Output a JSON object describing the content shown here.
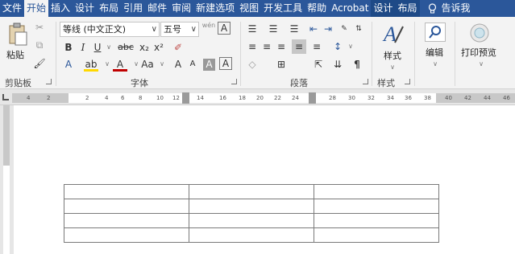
{
  "tabs": [
    {
      "label": "文件",
      "state": "normal"
    },
    {
      "label": "开始",
      "state": "active"
    },
    {
      "label": "插入",
      "state": "normal"
    },
    {
      "label": "设计",
      "state": "normal"
    },
    {
      "label": "布局",
      "state": "normal"
    },
    {
      "label": "引用",
      "state": "normal"
    },
    {
      "label": "邮件",
      "state": "normal"
    },
    {
      "label": "审阅",
      "state": "normal"
    },
    {
      "label": "新建选项",
      "state": "normal"
    },
    {
      "label": "视图",
      "state": "normal"
    },
    {
      "label": "开发工具",
      "state": "normal"
    },
    {
      "label": "帮助",
      "state": "normal"
    },
    {
      "label": "Acrobat",
      "state": "normal"
    },
    {
      "label": "设计",
      "state": "contextual"
    },
    {
      "label": "布局",
      "state": "contextual"
    }
  ],
  "tell_me": "告诉我",
  "clipboard": {
    "paste_label": "粘贴",
    "group_label": "剪贴板"
  },
  "font": {
    "name": "等线 (中文正文)",
    "size": "五号",
    "group_label": "字体",
    "buttons": {
      "bold": "B",
      "italic": "I",
      "underline": "U",
      "strike": "abc",
      "subscript": "x₂",
      "superscript": "x²",
      "change_case": "Aa",
      "grow": "A",
      "shrink": "A",
      "char_border": "A",
      "font_color": "A",
      "phonetic": "wén"
    }
  },
  "paragraph": {
    "group_label": "段落"
  },
  "styles": {
    "styles_label": "样式",
    "group_label": "样式"
  },
  "editing": {
    "label": "编辑"
  },
  "print_preview": {
    "label": "打印预览"
  },
  "ruler": {
    "numbers": [
      "4",
      "2",
      "2",
      "4",
      "6",
      "8",
      "10",
      "12",
      "14",
      "16",
      "18",
      "20",
      "22",
      "24",
      "28",
      "30",
      "32",
      "34",
      "36",
      "38",
      "40",
      "42",
      "44",
      "46"
    ]
  },
  "colors": {
    "tabbar": "#2b579a",
    "ribbon": "#f3f3f3",
    "highlight": "#ffd800",
    "font_color": "#c00000"
  },
  "document": {
    "table_rows": 4,
    "table_cols": 3
  }
}
